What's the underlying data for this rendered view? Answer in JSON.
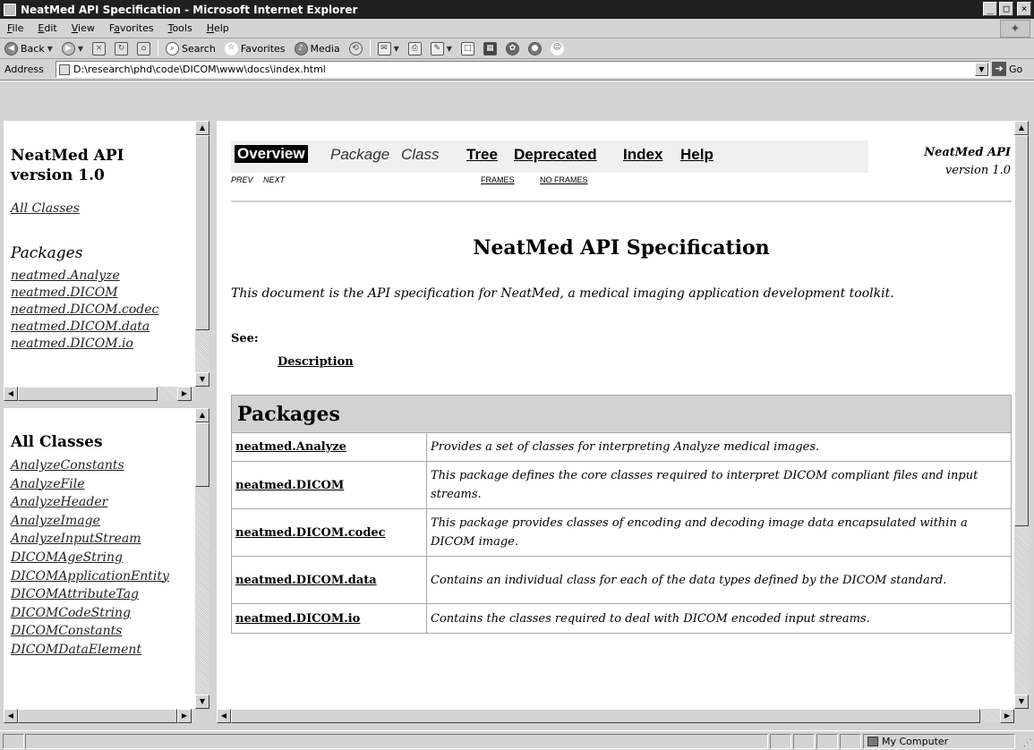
{
  "window": {
    "title": "NeatMed API Specification - Microsoft Internet Explorer",
    "buttons": [
      "_",
      "□",
      "×"
    ]
  },
  "menu": [
    "File",
    "Edit",
    "View",
    "Favorites",
    "Tools",
    "Help"
  ],
  "menu_mnemonics": [
    "F",
    "E",
    "V",
    "a",
    "T",
    "H"
  ],
  "toolbar": {
    "back": "Back",
    "search": "Search",
    "favorites": "Favorites",
    "media": "Media"
  },
  "address": {
    "label": "Address",
    "value": "D:\\research\\phd\\code\\DICOM\\www\\docs\\index.html",
    "go": "Go"
  },
  "packages_frame": {
    "title_line1": "NeatMed API",
    "title_line2": "version 1.0",
    "all_classes": "All Classes",
    "packages_heading": "Packages",
    "packages": [
      "neatmed.Analyze",
      "neatmed.DICOM",
      "neatmed.DICOM.codec",
      "neatmed.DICOM.data",
      "neatmed.DICOM.io"
    ]
  },
  "classes_frame": {
    "heading": "All Classes",
    "classes": [
      "AnalyzeConstants",
      "AnalyzeFile",
      "AnalyzeHeader",
      "AnalyzeImage",
      "AnalyzeInputStream",
      "DICOMAgeString",
      "DICOMApplicationEntity",
      "DICOMAttributeTag",
      "DICOMCodeString",
      "DICOMConstants",
      "DICOMDataElement"
    ]
  },
  "main": {
    "nav": {
      "overview": "Overview",
      "package": "Package",
      "class": "Class",
      "tree": "Tree",
      "deprecated": "Deprecated",
      "index": "Index",
      "help": "Help"
    },
    "subnav": {
      "prev": "PREV",
      "next": "NEXT",
      "frames": "FRAMES",
      "no_frames": "NO FRAMES"
    },
    "header_right_1": "NeatMed API",
    "header_right_2": "version 1.0",
    "title": "NeatMed API Specification",
    "description": "This document is the API specification for NeatMed, a medical imaging application development toolkit.",
    "see_label": "See:",
    "see_link": "Description",
    "table_heading": "Packages",
    "rows": [
      {
        "name": "neatmed.Analyze",
        "desc": "Provides a set of classes for interpreting Analyze medical images."
      },
      {
        "name": "neatmed.DICOM",
        "desc": "This package defines the core classes required to interpret DICOM compliant files and input streams."
      },
      {
        "name": "neatmed.DICOM.codec",
        "desc": "This package provides classes of encoding and decoding image data encapsulated within a DICOM image."
      },
      {
        "name": "neatmed.DICOM.data",
        "desc": "Contains an individual class for each of the data types defined by the DICOM standard."
      },
      {
        "name": "neatmed.DICOM.io",
        "desc": "Contains the classes required to deal with DICOM encoded input streams."
      }
    ]
  },
  "status": {
    "zone": "My Computer"
  }
}
